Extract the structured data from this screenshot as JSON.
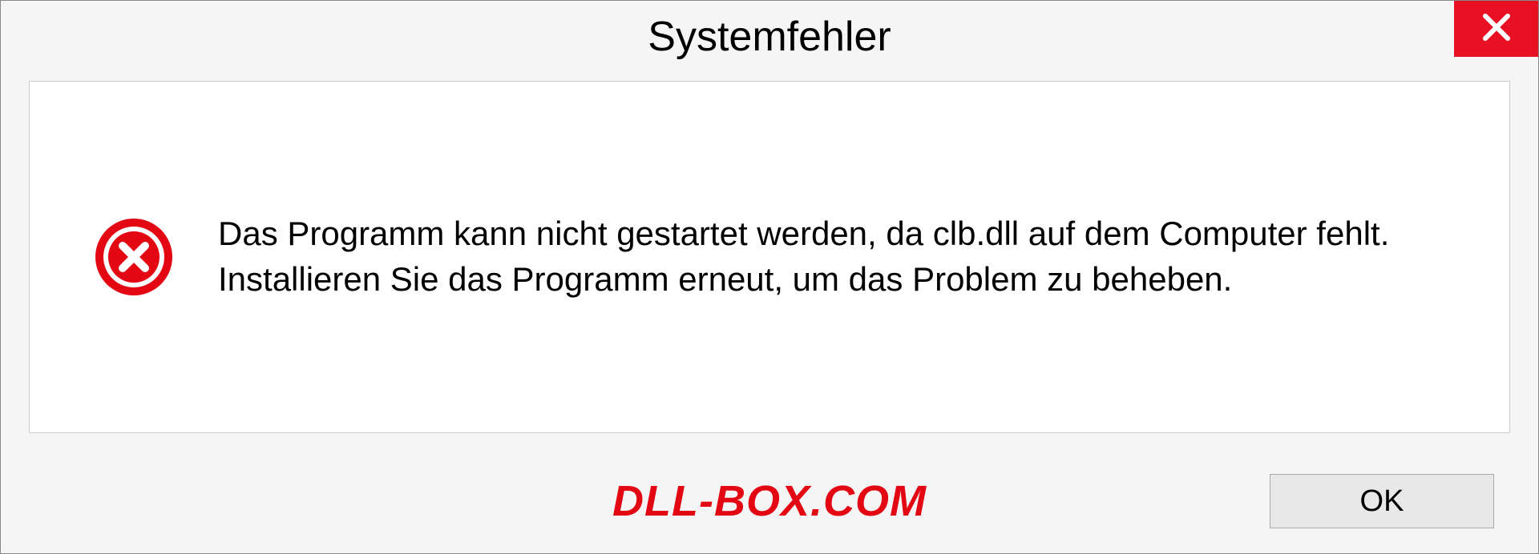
{
  "dialog": {
    "title": "Systemfehler",
    "message": "Das Programm kann nicht gestartet werden, da clb.dll auf dem Computer fehlt. Installieren Sie das Programm erneut, um das Problem zu beheben.",
    "ok_label": "OK"
  },
  "watermark": "DLL-BOX.COM"
}
